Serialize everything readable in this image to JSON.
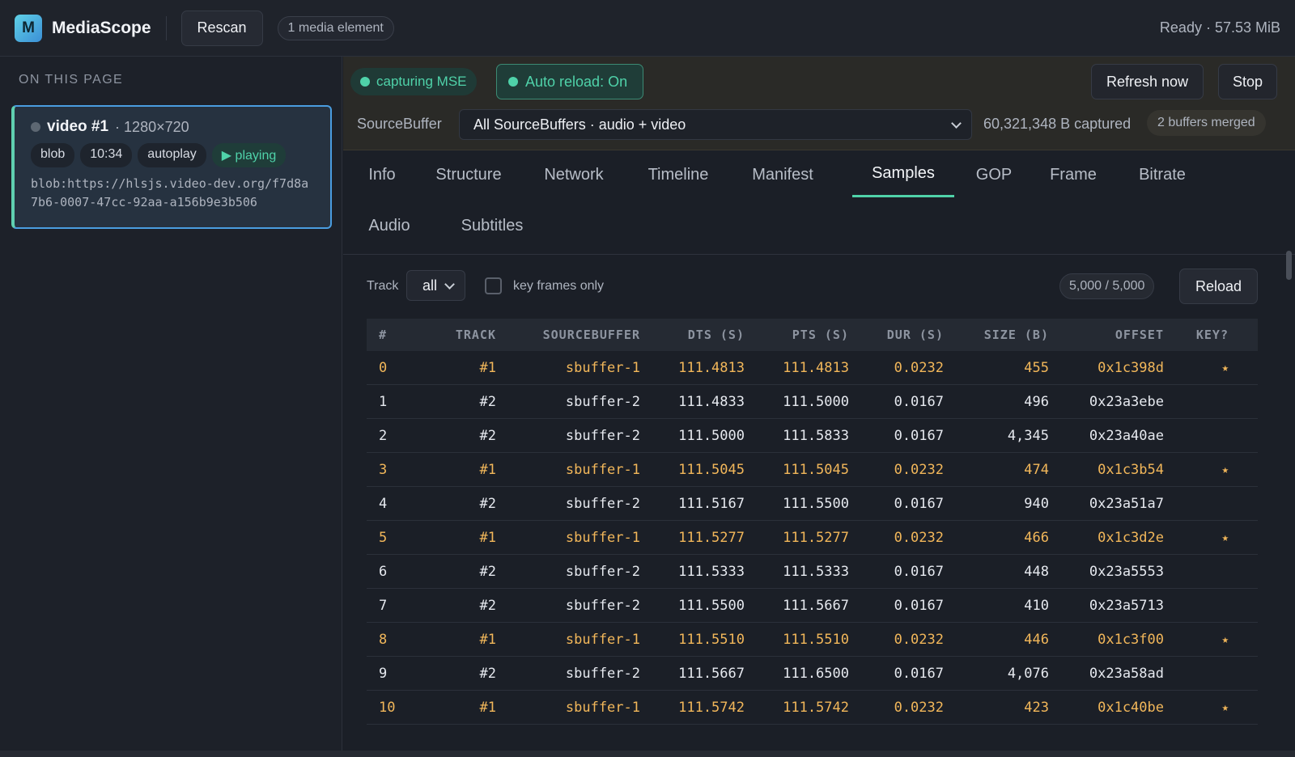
{
  "app": {
    "logo_letter": "M",
    "title": "MediaScope",
    "rescan_label": "Rescan",
    "media_count": "1 media element",
    "status": "Ready · 57.53 MiB"
  },
  "sidebar": {
    "heading": "ON THIS PAGE",
    "card": {
      "name": "video #1",
      "resolution": "· 1280×720",
      "tags": [
        "blob",
        "10:34",
        "autoplay",
        "▶ playing"
      ],
      "url": "blob:https://hlsjs.video-dev.org/f7d8a7b6-0007-47cc-92aa-a156b9e3b506"
    }
  },
  "capture": {
    "capturing": "capturing MSE",
    "auto_reload": "Auto reload: On",
    "refresh_label": "Refresh now",
    "stop_label": "Stop",
    "sourcebuffer_label": "SourceBuffer",
    "sourcebuffer_selected": "All SourceBuffers · audio + video",
    "captured": "60,321,348 B captured",
    "merged": "2 buffers merged"
  },
  "tabs": [
    "Info",
    "Structure",
    "Network",
    "Timeline",
    "Manifest",
    "Samples",
    "GOP",
    "Frame",
    "Bitrate",
    "Audio",
    "Subtitles"
  ],
  "active_tab": "Samples",
  "toolbar": {
    "track_label": "Track",
    "track_value": "all",
    "keyframes_label": "key frames only",
    "keyframes_checked": false,
    "count": "5,000 / 5,000",
    "reload_label": "Reload"
  },
  "table": {
    "columns": [
      "#",
      "TRACK",
      "SOURCEBUFFER",
      "DTS (S)",
      "PTS (S)",
      "DUR (S)",
      "SIZE (B)",
      "OFFSET",
      "KEY?"
    ],
    "rows": [
      {
        "idx": "0",
        "track": "#1",
        "sb": "sbuffer-1",
        "dts": "111.4813",
        "pts": "111.4813",
        "dur": "0.0232",
        "size": "455",
        "offset": "0x1c398d",
        "key": "★"
      },
      {
        "idx": "1",
        "track": "#2",
        "sb": "sbuffer-2",
        "dts": "111.4833",
        "pts": "111.5000",
        "dur": "0.0167",
        "size": "496",
        "offset": "0x23a3ebe",
        "key": ""
      },
      {
        "idx": "2",
        "track": "#2",
        "sb": "sbuffer-2",
        "dts": "111.5000",
        "pts": "111.5833",
        "dur": "0.0167",
        "size": "4,345",
        "offset": "0x23a40ae",
        "key": ""
      },
      {
        "idx": "3",
        "track": "#1",
        "sb": "sbuffer-1",
        "dts": "111.5045",
        "pts": "111.5045",
        "dur": "0.0232",
        "size": "474",
        "offset": "0x1c3b54",
        "key": "★"
      },
      {
        "idx": "4",
        "track": "#2",
        "sb": "sbuffer-2",
        "dts": "111.5167",
        "pts": "111.5500",
        "dur": "0.0167",
        "size": "940",
        "offset": "0x23a51a7",
        "key": ""
      },
      {
        "idx": "5",
        "track": "#1",
        "sb": "sbuffer-1",
        "dts": "111.5277",
        "pts": "111.5277",
        "dur": "0.0232",
        "size": "466",
        "offset": "0x1c3d2e",
        "key": "★"
      },
      {
        "idx": "6",
        "track": "#2",
        "sb": "sbuffer-2",
        "dts": "111.5333",
        "pts": "111.5333",
        "dur": "0.0167",
        "size": "448",
        "offset": "0x23a5553",
        "key": ""
      },
      {
        "idx": "7",
        "track": "#2",
        "sb": "sbuffer-2",
        "dts": "111.5500",
        "pts": "111.5667",
        "dur": "0.0167",
        "size": "410",
        "offset": "0x23a5713",
        "key": ""
      },
      {
        "idx": "8",
        "track": "#1",
        "sb": "sbuffer-1",
        "dts": "111.5510",
        "pts": "111.5510",
        "dur": "0.0232",
        "size": "446",
        "offset": "0x1c3f00",
        "key": "★"
      },
      {
        "idx": "9",
        "track": "#2",
        "sb": "sbuffer-2",
        "dts": "111.5667",
        "pts": "111.6500",
        "dur": "0.0167",
        "size": "4,076",
        "offset": "0x23a58ad",
        "key": ""
      },
      {
        "idx": "10",
        "track": "#1",
        "sb": "sbuffer-1",
        "dts": "111.5742",
        "pts": "111.5742",
        "dur": "0.0232",
        "size": "423",
        "offset": "0x1c40be",
        "key": "★"
      }
    ]
  }
}
